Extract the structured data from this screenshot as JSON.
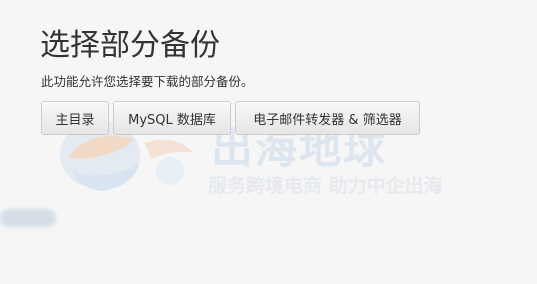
{
  "page": {
    "title": "选择部分备份",
    "description": "此功能允许您选择要下载的部分备份。"
  },
  "buttons": {
    "home": "主目录",
    "mysql": "MySQL 数据库",
    "email": "电子邮件转发器 & 筛选器"
  },
  "watermark": {
    "brand": "出海地球",
    "slogan": "服务跨境电商 助力中企出海"
  },
  "colors": {
    "background": "#f6f6f6",
    "text": "#333333",
    "button_border": "#cccccc",
    "watermark": "#dde5ee"
  }
}
